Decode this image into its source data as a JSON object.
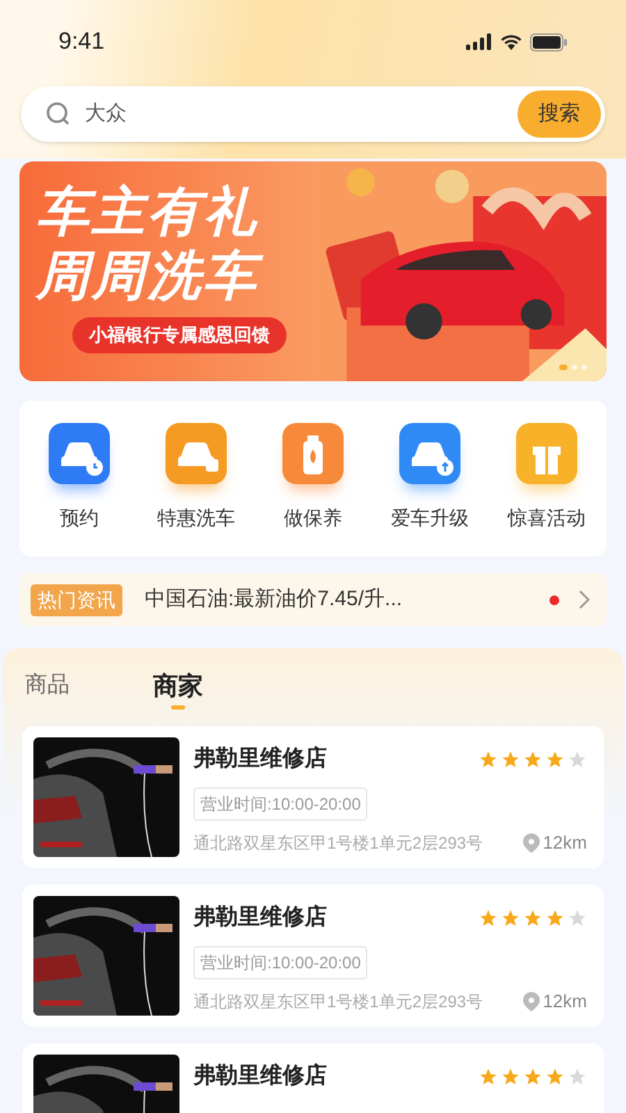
{
  "status_bar": {
    "time": "9:41"
  },
  "search": {
    "value": "大众",
    "button": "搜索"
  },
  "banner": {
    "title_lines": [
      "车主有礼",
      "周周洗车"
    ],
    "tag": "小福银行专属感恩回馈",
    "dots": [
      {
        "selected": true
      },
      {
        "selected": false
      },
      {
        "selected": false
      }
    ]
  },
  "services": [
    {
      "label": "预约",
      "kind": "booking",
      "color": "#2f7bf5"
    },
    {
      "label": "特惠洗车",
      "kind": "wash",
      "color": "#f59a23"
    },
    {
      "label": "做保养",
      "kind": "oil",
      "color": "#f78a3a"
    },
    {
      "label": "爱车升级",
      "kind": "upgrade",
      "color": "#2f8af5"
    },
    {
      "label": "惊喜活动",
      "kind": "gift",
      "color": "#f8b22a"
    }
  ],
  "news": {
    "badge": "热门资讯",
    "text": "中国石油:最新油价7.45/升...",
    "unread": true
  },
  "tabs": [
    {
      "label": "商品",
      "selected": false
    },
    {
      "label": "商家",
      "selected": true
    }
  ],
  "shops": [
    {
      "name": "弗勒里维修店",
      "stars": 4,
      "hours": "营业时间:10:00-20:00",
      "address": "通北路双星东区甲1号楼1单元2层293号",
      "distance": "12km"
    },
    {
      "name": "弗勒里维修店",
      "stars": 4,
      "hours": "营业时间:10:00-20:00",
      "address": "通北路双星东区甲1号楼1单元2层293号",
      "distance": "12km"
    },
    {
      "name": "弗勒里维修店",
      "stars": 4
    }
  ]
}
